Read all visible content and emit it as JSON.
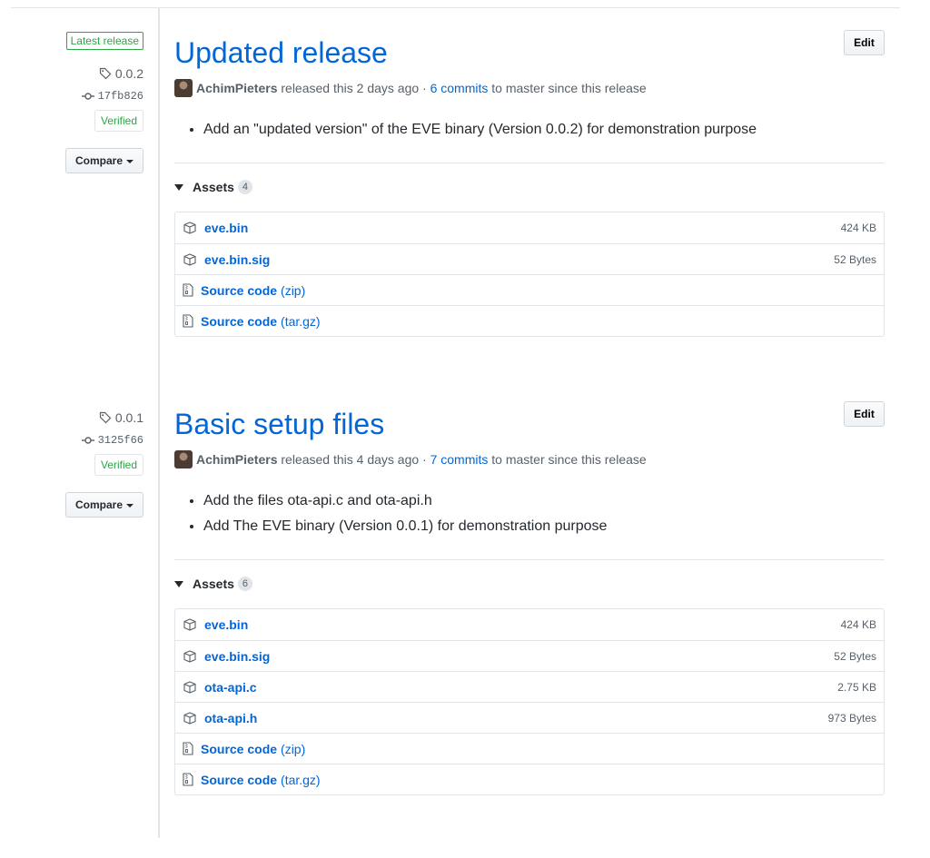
{
  "releases": [
    {
      "latest_badge": "Latest release",
      "tag": "0.0.2",
      "commit": "17fb826",
      "verified": "Verified",
      "compare": "Compare",
      "title": "Updated release",
      "edit": "Edit",
      "author": "AchimPieters",
      "released_text": "released this 2 days ago ·",
      "commits_link": "6 commits",
      "since_text": "to master since this release",
      "notes": [
        "Add an \"updated version\" of the EVE binary (Version 0.0.2) for demonstration purpose"
      ],
      "assets_label": "Assets",
      "assets_count": "4",
      "assets": [
        {
          "name": "eve.bin",
          "size": "424 KB",
          "icon": "package-icon"
        },
        {
          "name": "eve.bin.sig",
          "size": "52 Bytes",
          "icon": "package-icon"
        },
        {
          "name": "Source code",
          "ext": "(zip)",
          "icon": "file-zip-icon"
        },
        {
          "name": "Source code",
          "ext": "(tar.gz)",
          "icon": "file-zip-icon"
        }
      ]
    },
    {
      "tag": "0.0.1",
      "commit": "3125f66",
      "verified": "Verified",
      "compare": "Compare",
      "title": "Basic setup files",
      "edit": "Edit",
      "author": "AchimPieters",
      "released_text": "released this 4 days ago ·",
      "commits_link": "7 commits",
      "since_text": "to master since this release",
      "notes": [
        "Add the files ota-api.c and ota-api.h",
        "Add The EVE binary (Version 0.0.1) for demonstration purpose"
      ],
      "assets_label": "Assets",
      "assets_count": "6",
      "assets": [
        {
          "name": "eve.bin",
          "size": "424 KB",
          "icon": "package-icon"
        },
        {
          "name": "eve.bin.sig",
          "size": "52 Bytes",
          "icon": "package-icon"
        },
        {
          "name": "ota-api.c",
          "size": "2.75 KB",
          "icon": "package-icon"
        },
        {
          "name": "ota-api.h",
          "size": "973 Bytes",
          "icon": "package-icon"
        },
        {
          "name": "Source code",
          "ext": "(zip)",
          "icon": "file-zip-icon"
        },
        {
          "name": "Source code",
          "ext": "(tar.gz)",
          "icon": "file-zip-icon"
        }
      ]
    }
  ]
}
